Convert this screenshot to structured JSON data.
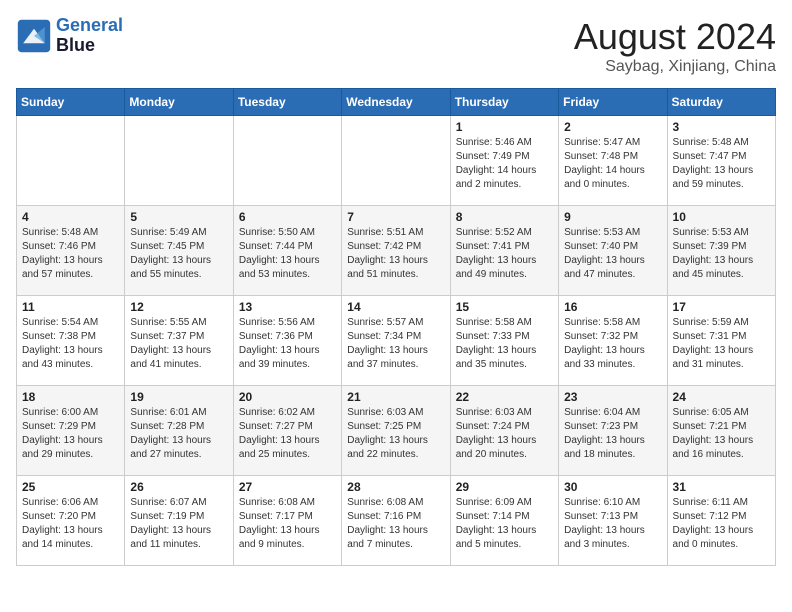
{
  "header": {
    "logo_line1": "General",
    "logo_line2": "Blue",
    "month_title": "August 2024",
    "subtitle": "Saybag, Xinjiang, China"
  },
  "weekdays": [
    "Sunday",
    "Monday",
    "Tuesday",
    "Wednesday",
    "Thursday",
    "Friday",
    "Saturday"
  ],
  "weeks": [
    [
      {
        "day": "",
        "info": ""
      },
      {
        "day": "",
        "info": ""
      },
      {
        "day": "",
        "info": ""
      },
      {
        "day": "",
        "info": ""
      },
      {
        "day": "1",
        "info": "Sunrise: 5:46 AM\nSunset: 7:49 PM\nDaylight: 14 hours\nand 2 minutes."
      },
      {
        "day": "2",
        "info": "Sunrise: 5:47 AM\nSunset: 7:48 PM\nDaylight: 14 hours\nand 0 minutes."
      },
      {
        "day": "3",
        "info": "Sunrise: 5:48 AM\nSunset: 7:47 PM\nDaylight: 13 hours\nand 59 minutes."
      }
    ],
    [
      {
        "day": "4",
        "info": "Sunrise: 5:48 AM\nSunset: 7:46 PM\nDaylight: 13 hours\nand 57 minutes."
      },
      {
        "day": "5",
        "info": "Sunrise: 5:49 AM\nSunset: 7:45 PM\nDaylight: 13 hours\nand 55 minutes."
      },
      {
        "day": "6",
        "info": "Sunrise: 5:50 AM\nSunset: 7:44 PM\nDaylight: 13 hours\nand 53 minutes."
      },
      {
        "day": "7",
        "info": "Sunrise: 5:51 AM\nSunset: 7:42 PM\nDaylight: 13 hours\nand 51 minutes."
      },
      {
        "day": "8",
        "info": "Sunrise: 5:52 AM\nSunset: 7:41 PM\nDaylight: 13 hours\nand 49 minutes."
      },
      {
        "day": "9",
        "info": "Sunrise: 5:53 AM\nSunset: 7:40 PM\nDaylight: 13 hours\nand 47 minutes."
      },
      {
        "day": "10",
        "info": "Sunrise: 5:53 AM\nSunset: 7:39 PM\nDaylight: 13 hours\nand 45 minutes."
      }
    ],
    [
      {
        "day": "11",
        "info": "Sunrise: 5:54 AM\nSunset: 7:38 PM\nDaylight: 13 hours\nand 43 minutes."
      },
      {
        "day": "12",
        "info": "Sunrise: 5:55 AM\nSunset: 7:37 PM\nDaylight: 13 hours\nand 41 minutes."
      },
      {
        "day": "13",
        "info": "Sunrise: 5:56 AM\nSunset: 7:36 PM\nDaylight: 13 hours\nand 39 minutes."
      },
      {
        "day": "14",
        "info": "Sunrise: 5:57 AM\nSunset: 7:34 PM\nDaylight: 13 hours\nand 37 minutes."
      },
      {
        "day": "15",
        "info": "Sunrise: 5:58 AM\nSunset: 7:33 PM\nDaylight: 13 hours\nand 35 minutes."
      },
      {
        "day": "16",
        "info": "Sunrise: 5:58 AM\nSunset: 7:32 PM\nDaylight: 13 hours\nand 33 minutes."
      },
      {
        "day": "17",
        "info": "Sunrise: 5:59 AM\nSunset: 7:31 PM\nDaylight: 13 hours\nand 31 minutes."
      }
    ],
    [
      {
        "day": "18",
        "info": "Sunrise: 6:00 AM\nSunset: 7:29 PM\nDaylight: 13 hours\nand 29 minutes."
      },
      {
        "day": "19",
        "info": "Sunrise: 6:01 AM\nSunset: 7:28 PM\nDaylight: 13 hours\nand 27 minutes."
      },
      {
        "day": "20",
        "info": "Sunrise: 6:02 AM\nSunset: 7:27 PM\nDaylight: 13 hours\nand 25 minutes."
      },
      {
        "day": "21",
        "info": "Sunrise: 6:03 AM\nSunset: 7:25 PM\nDaylight: 13 hours\nand 22 minutes."
      },
      {
        "day": "22",
        "info": "Sunrise: 6:03 AM\nSunset: 7:24 PM\nDaylight: 13 hours\nand 20 minutes."
      },
      {
        "day": "23",
        "info": "Sunrise: 6:04 AM\nSunset: 7:23 PM\nDaylight: 13 hours\nand 18 minutes."
      },
      {
        "day": "24",
        "info": "Sunrise: 6:05 AM\nSunset: 7:21 PM\nDaylight: 13 hours\nand 16 minutes."
      }
    ],
    [
      {
        "day": "25",
        "info": "Sunrise: 6:06 AM\nSunset: 7:20 PM\nDaylight: 13 hours\nand 14 minutes."
      },
      {
        "day": "26",
        "info": "Sunrise: 6:07 AM\nSunset: 7:19 PM\nDaylight: 13 hours\nand 11 minutes."
      },
      {
        "day": "27",
        "info": "Sunrise: 6:08 AM\nSunset: 7:17 PM\nDaylight: 13 hours\nand 9 minutes."
      },
      {
        "day": "28",
        "info": "Sunrise: 6:08 AM\nSunset: 7:16 PM\nDaylight: 13 hours\nand 7 minutes."
      },
      {
        "day": "29",
        "info": "Sunrise: 6:09 AM\nSunset: 7:14 PM\nDaylight: 13 hours\nand 5 minutes."
      },
      {
        "day": "30",
        "info": "Sunrise: 6:10 AM\nSunset: 7:13 PM\nDaylight: 13 hours\nand 3 minutes."
      },
      {
        "day": "31",
        "info": "Sunrise: 6:11 AM\nSunset: 7:12 PM\nDaylight: 13 hours\nand 0 minutes."
      }
    ]
  ]
}
